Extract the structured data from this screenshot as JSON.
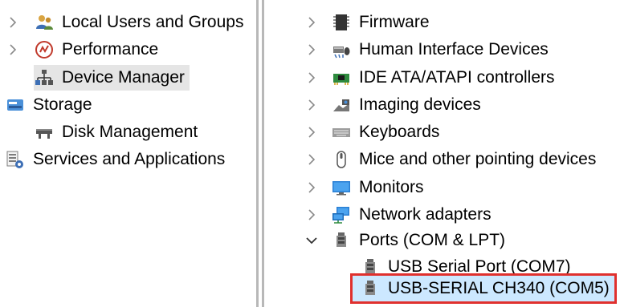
{
  "left_tree": {
    "items": [
      {
        "label": "Local Users and Groups",
        "icon": "users-icon"
      },
      {
        "label": "Performance",
        "icon": "performance-icon"
      },
      {
        "label": "Device Manager",
        "icon": "device-manager-icon"
      },
      {
        "label": "Storage",
        "icon": "storage-icon"
      },
      {
        "label": "Disk Management",
        "icon": "disk-management-icon"
      },
      {
        "label": "Services and Applications",
        "icon": "services-icon"
      }
    ]
  },
  "device_tree": {
    "items": [
      {
        "label": "Firmware",
        "icon": "firmware-icon"
      },
      {
        "label": "Human Interface Devices",
        "icon": "hid-icon"
      },
      {
        "label": "IDE ATA/ATAPI controllers",
        "icon": "ide-controller-icon"
      },
      {
        "label": "Imaging devices",
        "icon": "camera-icon"
      },
      {
        "label": "Keyboards",
        "icon": "keyboard-icon"
      },
      {
        "label": "Mice and other pointing devices",
        "icon": "mouse-icon"
      },
      {
        "label": "Monitors",
        "icon": "monitor-icon"
      },
      {
        "label": "Network adapters",
        "icon": "network-icon"
      },
      {
        "label": "Ports (COM & LPT)",
        "icon": "port-icon"
      },
      {
        "label": "USB Serial Port (COM7)",
        "icon": "port-icon"
      },
      {
        "label": "USB-SERIAL CH340 (COM5)",
        "icon": "port-icon"
      }
    ]
  },
  "colors": {
    "selection_gray": "#e5e5e5",
    "selection_blue": "#cce8ff",
    "highlight_red": "#e0302e"
  }
}
